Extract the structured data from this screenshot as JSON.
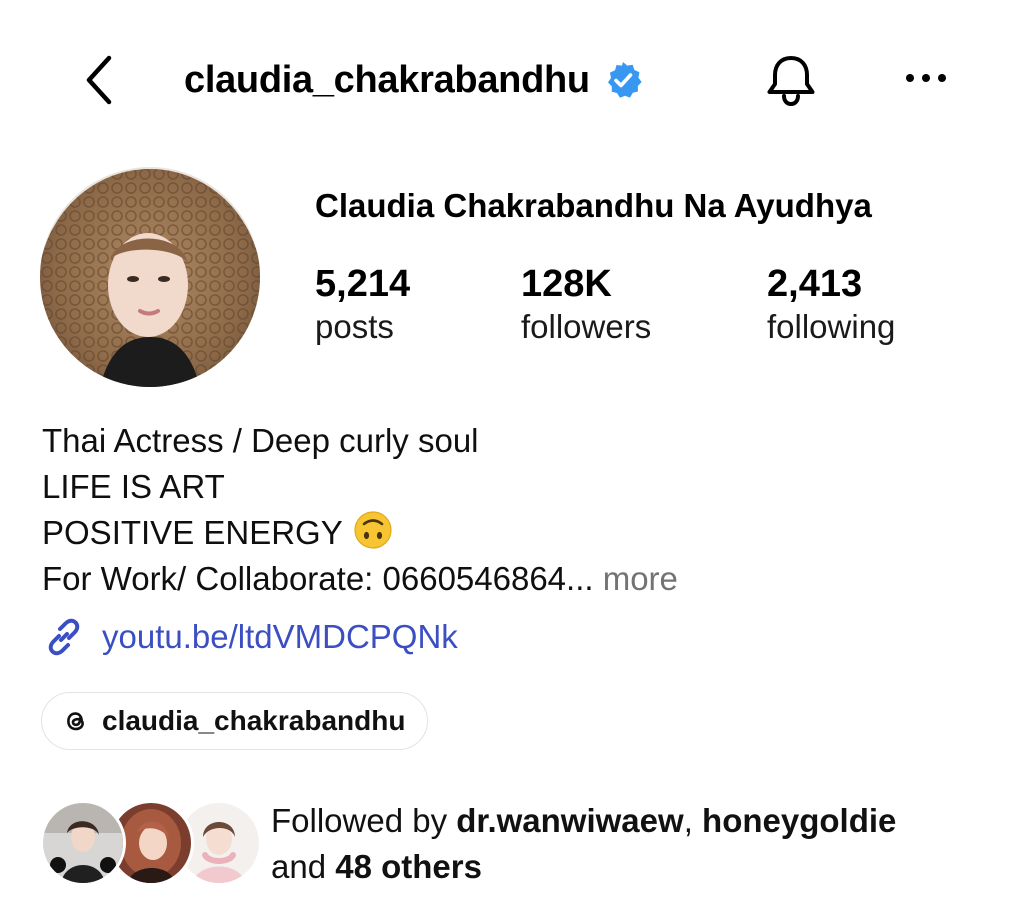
{
  "header": {
    "username": "claudia_chakrabandhu",
    "icons": {
      "back": "chevron-left-icon",
      "verified": "verified-badge-icon",
      "notifications": "bell-icon",
      "more": "more-horizontal-icon"
    }
  },
  "profile": {
    "full_name": "Claudia Chakrabandhu Na Ayudhya",
    "stats": {
      "posts": {
        "value": "5,214",
        "label": "posts"
      },
      "followers": {
        "value": "128K",
        "label": "followers"
      },
      "following": {
        "value": "2,413",
        "label": "following"
      }
    }
  },
  "bio": {
    "line1": "Thai Actress / Deep curly soul",
    "line2": "LIFE IS ART",
    "line3": "POSITIVE ENERGY",
    "line4": "For Work/ Collaborate: 0660546864...",
    "more": " more",
    "link": "youtu.be/ltdVMDCPQNk",
    "threads_handle": "claudia_chakrabandhu"
  },
  "followed_by": {
    "prefix": "Followed by ",
    "user1": "dr.wanwiwaew",
    "separator": ", ",
    "user2": "honeygoldie",
    "and": "and ",
    "others": "48 others"
  },
  "colors": {
    "link": "#3b4fc2",
    "verified": "#3897f0",
    "muted": "#737373"
  }
}
